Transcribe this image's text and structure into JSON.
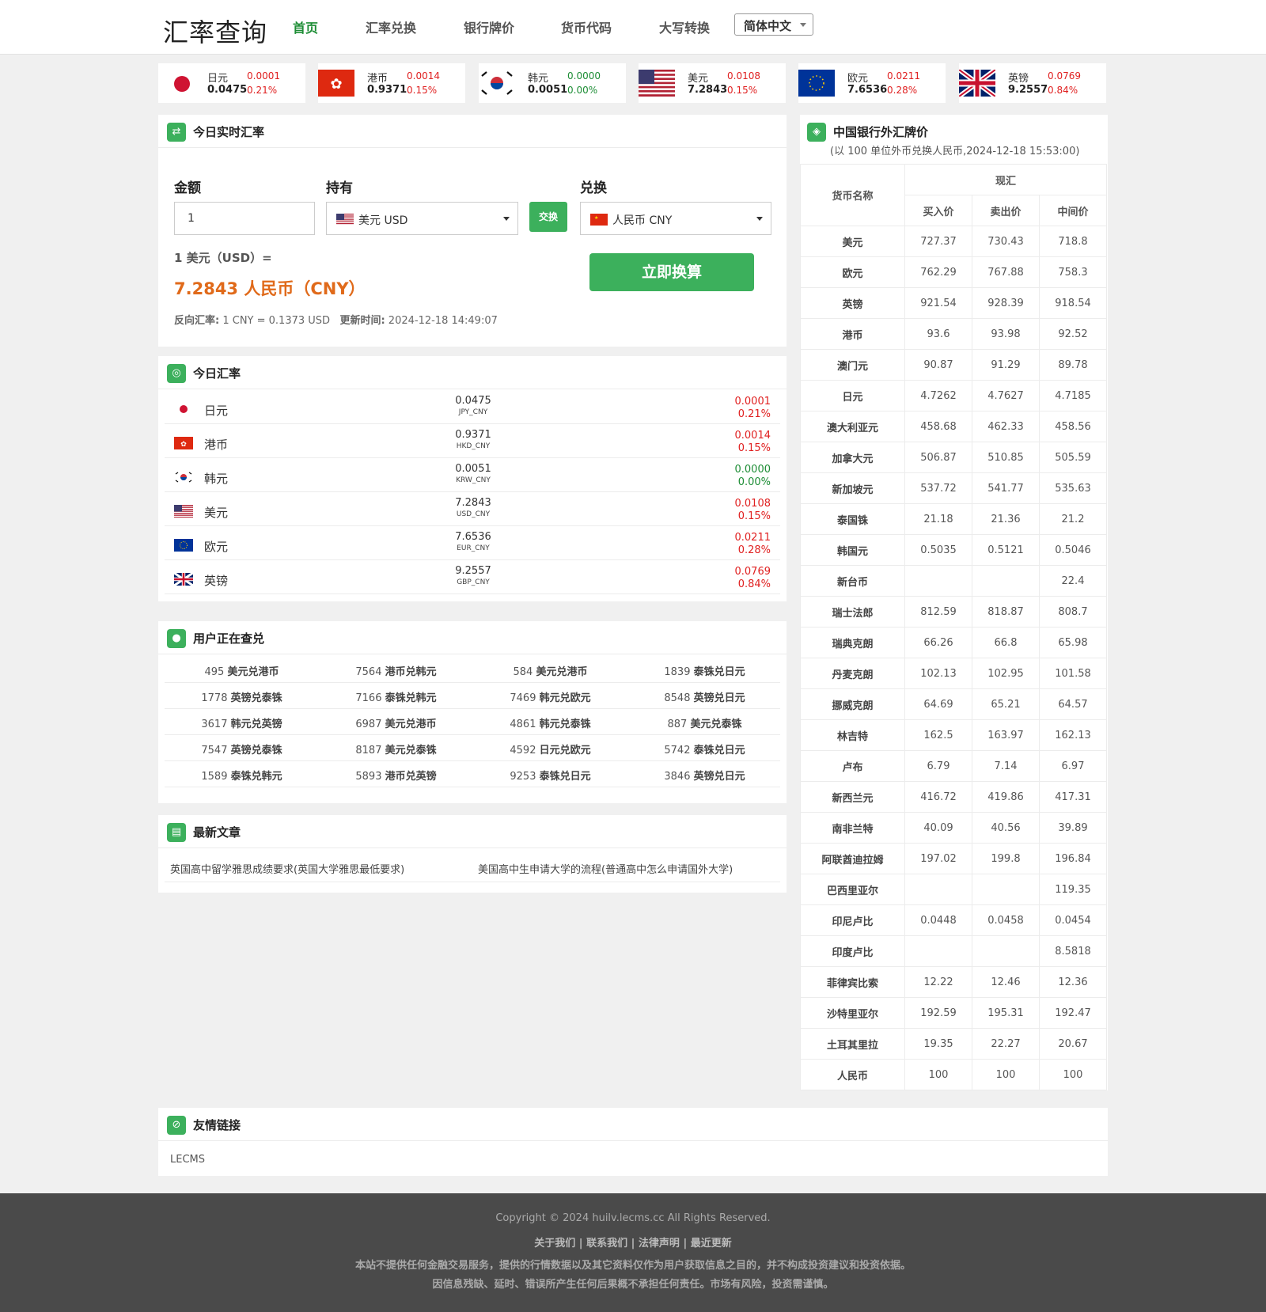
{
  "header": {
    "logo": "汇率查询",
    "nav": [
      "首页",
      "汇率兑换",
      "银行牌价",
      "货币代码",
      "大写转换"
    ],
    "lang": "简体中文"
  },
  "ticker": [
    {
      "name": "日元",
      "rate": "0.0475",
      "change": "0.0001",
      "pct": "0.21%",
      "dir": "up"
    },
    {
      "name": "港币",
      "rate": "0.9371",
      "change": "0.0014",
      "pct": "0.15%",
      "dir": "up"
    },
    {
      "name": "韩元",
      "rate": "0.0051",
      "change": "0.0000",
      "pct": "0.00%",
      "dir": "flat"
    },
    {
      "name": "美元",
      "rate": "7.2843",
      "change": "0.0108",
      "pct": "0.15%",
      "dir": "up"
    },
    {
      "name": "欧元",
      "rate": "7.6536",
      "change": "0.0211",
      "pct": "0.28%",
      "dir": "up"
    },
    {
      "name": "英镑",
      "rate": "9.2557",
      "change": "0.0769",
      "pct": "0.84%",
      "dir": "up"
    }
  ],
  "converter": {
    "title": "今日实时汇率",
    "amount_label": "金额",
    "hold_label": "持有",
    "to_label": "兑换",
    "amount_value": "1",
    "from_currency": "美元 USD",
    "to_currency": "人民币 CNY",
    "swap_label": "交换",
    "result_line1": "1 美元（USD）=",
    "result_line2": "7.2843 人民币（CNY）",
    "reverse_label": "反向汇率:",
    "reverse_value": "1 CNY = 0.1373 USD",
    "updated_label": "更新时间:",
    "updated_value": "2024-12-18 14:49:07",
    "go_label": "立即换算"
  },
  "today": {
    "title": "今日汇率",
    "rows": [
      {
        "name": "日元",
        "value": "0.0475",
        "pair": "JPY_CNY",
        "change": "0.0001",
        "pct": "0.21%",
        "dir": "up"
      },
      {
        "name": "港币",
        "value": "0.9371",
        "pair": "HKD_CNY",
        "change": "0.0014",
        "pct": "0.15%",
        "dir": "up"
      },
      {
        "name": "韩元",
        "value": "0.0051",
        "pair": "KRW_CNY",
        "change": "0.0000",
        "pct": "0.00%",
        "dir": "flat"
      },
      {
        "name": "美元",
        "value": "7.2843",
        "pair": "USD_CNY",
        "change": "0.0108",
        "pct": "0.15%",
        "dir": "up"
      },
      {
        "name": "欧元",
        "value": "7.6536",
        "pair": "EUR_CNY",
        "change": "0.0211",
        "pct": "0.28%",
        "dir": "up"
      },
      {
        "name": "英镑",
        "value": "9.2557",
        "pair": "GBP_CNY",
        "change": "0.0769",
        "pct": "0.84%",
        "dir": "up"
      }
    ]
  },
  "users": {
    "title": "用户正在查兑",
    "rows": [
      [
        [
          "495",
          "美元兑港币"
        ],
        [
          "7564",
          "港币兑韩元"
        ],
        [
          "584",
          "美元兑港币"
        ],
        [
          "1839",
          "泰铢兑日元"
        ]
      ],
      [
        [
          "1778",
          "英镑兑泰铢"
        ],
        [
          "7166",
          "泰铢兑韩元"
        ],
        [
          "7469",
          "韩元兑欧元"
        ],
        [
          "8548",
          "英镑兑日元"
        ]
      ],
      [
        [
          "3617",
          "韩元兑英镑"
        ],
        [
          "6987",
          "美元兑港币"
        ],
        [
          "4861",
          "韩元兑泰铢"
        ],
        [
          "887",
          "美元兑泰铢"
        ]
      ],
      [
        [
          "7547",
          "英镑兑泰铢"
        ],
        [
          "8187",
          "美元兑泰铢"
        ],
        [
          "4592",
          "日元兑欧元"
        ],
        [
          "5742",
          "泰铢兑日元"
        ]
      ],
      [
        [
          "1589",
          "泰铢兑韩元"
        ],
        [
          "5893",
          "港币兑英镑"
        ],
        [
          "9253",
          "泰铢兑日元"
        ],
        [
          "3846",
          "英镑兑日元"
        ]
      ]
    ]
  },
  "articles": {
    "title": "最新文章",
    "items": [
      "英国高中留学雅思成绩要求(英国大学雅思最低要求)",
      "美国高中生申请大学的流程(普通高中怎么申请国外大学)"
    ]
  },
  "bank": {
    "title": "中国银行外汇牌价",
    "subtitle": "(以 100 单位外币兑换人民币,2024-12-18 15:53:00)",
    "col_name": "货币名称",
    "col_group": "现汇",
    "col_buy": "买入价",
    "col_sell": "卖出价",
    "col_mid": "中间价",
    "rows": [
      [
        "美元",
        "727.37",
        "730.43",
        "718.8"
      ],
      [
        "欧元",
        "762.29",
        "767.88",
        "758.3"
      ],
      [
        "英镑",
        "921.54",
        "928.39",
        "918.54"
      ],
      [
        "港币",
        "93.6",
        "93.98",
        "92.52"
      ],
      [
        "澳门元",
        "90.87",
        "91.29",
        "89.78"
      ],
      [
        "日元",
        "4.7262",
        "4.7627",
        "4.7185"
      ],
      [
        "澳大利亚元",
        "458.68",
        "462.33",
        "458.56"
      ],
      [
        "加拿大元",
        "506.87",
        "510.85",
        "505.59"
      ],
      [
        "新加坡元",
        "537.72",
        "541.77",
        "535.63"
      ],
      [
        "泰国铢",
        "21.18",
        "21.36",
        "21.2"
      ],
      [
        "韩国元",
        "0.5035",
        "0.5121",
        "0.5046"
      ],
      [
        "新台币",
        "",
        "",
        "22.4"
      ],
      [
        "瑞士法郎",
        "812.59",
        "818.87",
        "808.7"
      ],
      [
        "瑞典克朗",
        "66.26",
        "66.8",
        "65.98"
      ],
      [
        "丹麦克朗",
        "102.13",
        "102.95",
        "101.58"
      ],
      [
        "挪威克朗",
        "64.69",
        "65.21",
        "64.57"
      ],
      [
        "林吉特",
        "162.5",
        "163.97",
        "162.13"
      ],
      [
        "卢布",
        "6.79",
        "7.14",
        "6.97"
      ],
      [
        "新西兰元",
        "416.72",
        "419.86",
        "417.31"
      ],
      [
        "南非兰特",
        "40.09",
        "40.56",
        "39.89"
      ],
      [
        "阿联酋迪拉姆",
        "197.02",
        "199.8",
        "196.84"
      ],
      [
        "巴西里亚尔",
        "",
        "",
        "119.35"
      ],
      [
        "印尼卢比",
        "0.0448",
        "0.0458",
        "0.0454"
      ],
      [
        "印度卢比",
        "",
        "",
        "8.5818"
      ],
      [
        "菲律宾比索",
        "12.22",
        "12.46",
        "12.36"
      ],
      [
        "沙特里亚尔",
        "192.59",
        "195.31",
        "192.47"
      ],
      [
        "土耳其里拉",
        "19.35",
        "22.27",
        "20.67"
      ],
      [
        "人民币",
        "100",
        "100",
        "100"
      ]
    ]
  },
  "links": {
    "title": "友情链接",
    "items": [
      "LECMS"
    ]
  },
  "footer": {
    "copyright": "Copyright © 2024 huilv.lecms.cc All Rights Reserved.",
    "links": [
      "关于我们",
      "联系我们",
      "法律声明",
      "最近更新"
    ],
    "disclaimer1": "本站不提供任何金融交易服务，提供的行情数据以及其它资料仅作为用户获取信息之目的，并不构成投资建议和投资依据。",
    "disclaimer2": "因信息残缺、延时、错误所产生任何后果概不承担任何责任。市场有风险，投资需谨慎。"
  },
  "colors": {
    "accent": "#3cb05c",
    "up": "#e02020",
    "flat": "#1d8d35",
    "result": "#e06a1a",
    "footer_bg": "#4a4a4a"
  }
}
